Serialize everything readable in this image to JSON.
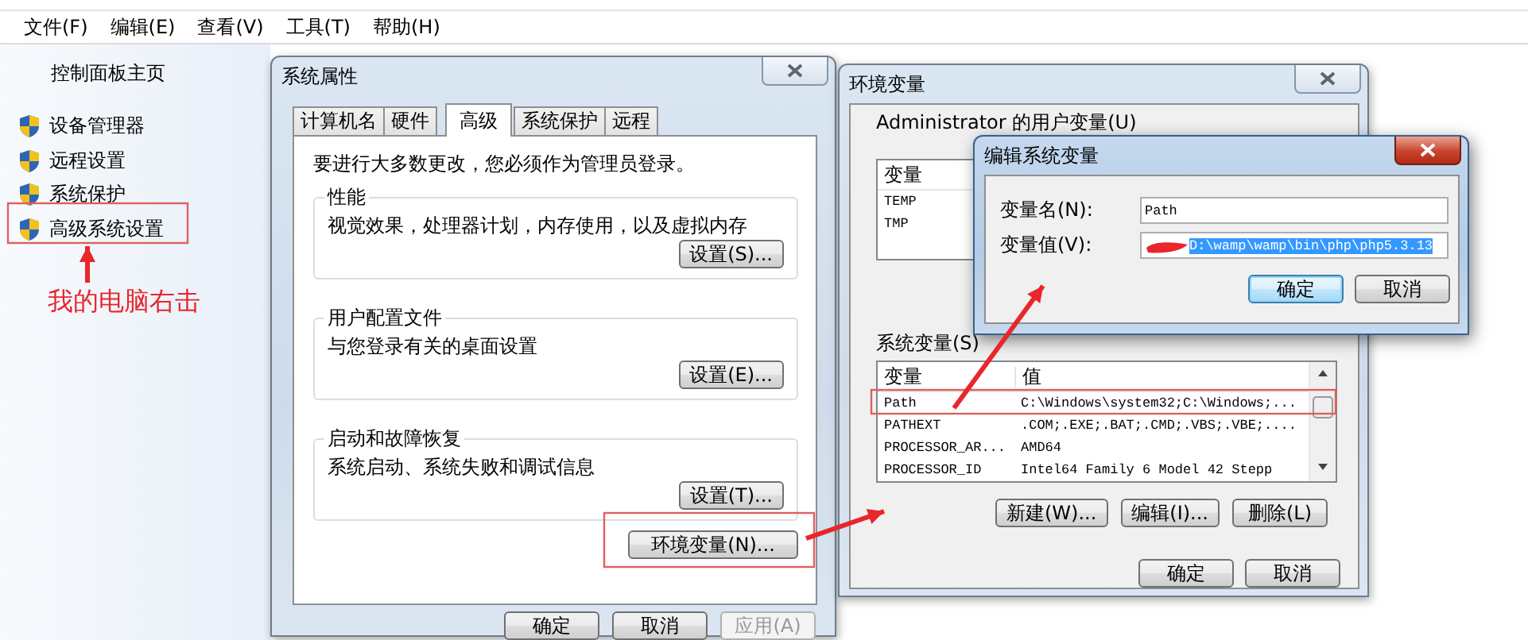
{
  "menu_bar": [
    "文件(F)",
    "编辑(E)",
    "查看(V)",
    "工具(T)",
    "帮助(H)"
  ],
  "sidebar": {
    "home": "控制面板主页",
    "items": [
      {
        "label": "设备管理器"
      },
      {
        "label": "远程设置"
      },
      {
        "label": "系统保护"
      },
      {
        "label": "高级系统设置"
      }
    ]
  },
  "annotation": "我的电脑右击",
  "system_properties": {
    "title": "系统属性",
    "active": false,
    "tabs": [
      {
        "label": "计算机名",
        "selected": false
      },
      {
        "label": "硬件",
        "selected": false
      },
      {
        "label": "高级",
        "selected": true
      },
      {
        "label": "系统保护",
        "selected": false
      },
      {
        "label": "远程",
        "selected": false
      }
    ],
    "notice": "要进行大多数更改，您必须作为管理员登录。",
    "groups": [
      {
        "title": "性能",
        "description": "视觉效果，处理器计划，内存使用，以及虚拟内存",
        "button": "设置(S)..."
      },
      {
        "title": "用户配置文件",
        "description": "与您登录有关的桌面设置",
        "button": "设置(E)..."
      },
      {
        "title": "启动和故障恢复",
        "description": "系统启动、系统失败和调试信息",
        "button": "设置(T)..."
      }
    ],
    "env_button": "环境变量(N)...",
    "buttons": [
      {
        "label": "确定",
        "disabled": false
      },
      {
        "label": "取消",
        "disabled": false
      },
      {
        "label": "应用(A)",
        "disabled": true
      }
    ]
  },
  "environment_variables": {
    "title": "环境变量",
    "active": false,
    "user_label": "Administrator 的用户变量(U)",
    "user_table": {
      "columns": [
        "变量"
      ],
      "rows": [
        [
          "TEMP"
        ],
        [
          "TMP"
        ]
      ]
    },
    "system_label": "系统变量(S)",
    "system_table": {
      "columns": [
        "变量",
        "值"
      ],
      "rows": [
        [
          "Path",
          "C:\\Windows\\system32;C:\\Windows;..."
        ],
        [
          "PATHEXT",
          ".COM;.EXE;.BAT;.CMD;.VBS;.VBE;...."
        ],
        [
          "PROCESSOR_AR...",
          "AMD64"
        ],
        [
          "PROCESSOR_ID",
          "Intel64 Family 6 Model 42 Stepp"
        ]
      ]
    },
    "list_buttons": [
      "新建(W)...",
      "编辑(I)...",
      "删除(L)"
    ],
    "buttons": [
      "确定",
      "取消"
    ]
  },
  "edit_dialog": {
    "title": "编辑系统变量",
    "active": true,
    "fields": [
      {
        "label": "变量名(N):",
        "value": "Path",
        "selected": false,
        "redacted": false
      },
      {
        "label": "变量值(V):",
        "value": "D:\\wamp\\wamp\\bin\\php\\php5.3.13",
        "selected": true,
        "redacted": true
      }
    ],
    "buttons": [
      {
        "label": "确定",
        "default": true
      },
      {
        "label": "取消",
        "default": false
      }
    ]
  }
}
